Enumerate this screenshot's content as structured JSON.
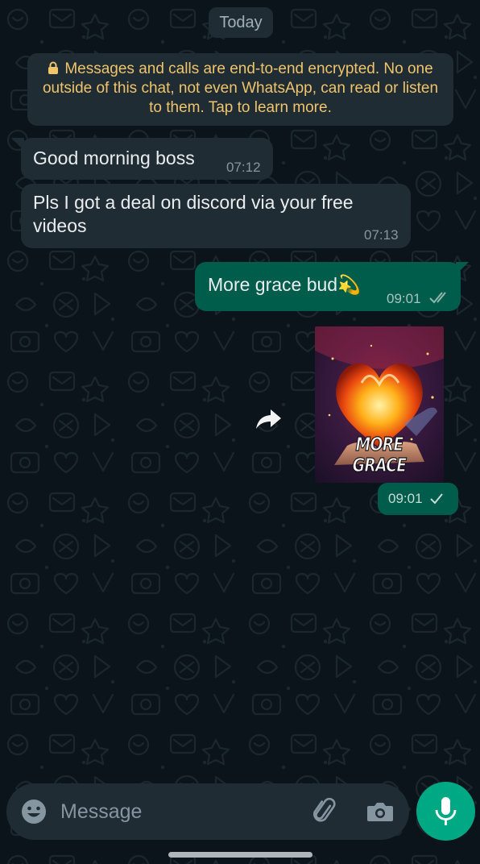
{
  "chat": {
    "date_separator": "Today",
    "encryption_notice": "Messages and calls are end-to-end encrypted. No one outside of this chat, not even WhatsApp, can read or listen to them. Tap to learn more.",
    "messages": [
      {
        "direction": "incoming",
        "text": "Good morning boss",
        "time": "07:12"
      },
      {
        "direction": "incoming",
        "text": "Pls I got a deal on discord via your free videos",
        "time": "07:13"
      },
      {
        "direction": "outgoing",
        "text": "More grace bud",
        "emoji": "💫",
        "time": "09:01",
        "status": "read"
      },
      {
        "direction": "outgoing",
        "type": "sticker",
        "sticker_caption": "MORE GRACE",
        "time": "09:01",
        "status": "sent"
      }
    ]
  },
  "composer": {
    "placeholder": "Message",
    "value": ""
  },
  "icons": {
    "emoji": "emoji-icon",
    "attach": "paperclip-icon",
    "camera": "camera-icon",
    "mic": "microphone-icon",
    "forward": "forward-icon",
    "lock": "lock-icon",
    "double_check": "double-check-icon",
    "single_check": "single-check-icon"
  },
  "colors": {
    "background": "#0b141a",
    "incoming_bubble": "#202c33",
    "outgoing_bubble": "#005c4b",
    "accent": "#00a884",
    "notice_text": "#f0c46b",
    "read_receipt": "#8fb6ad"
  }
}
